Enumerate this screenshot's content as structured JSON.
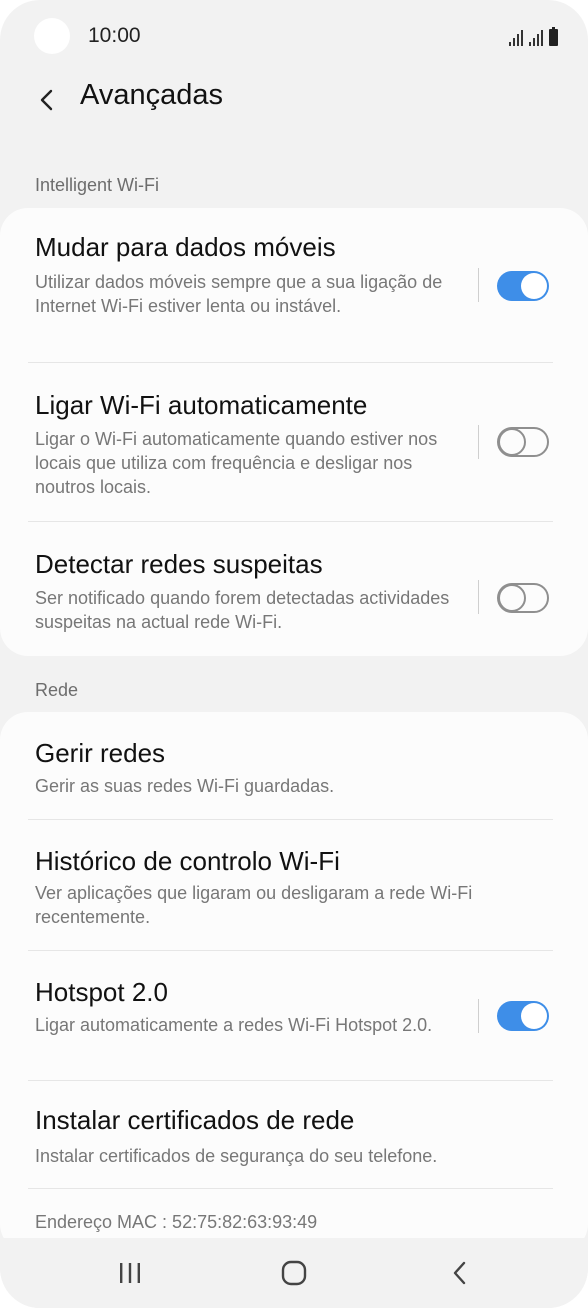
{
  "status_bar": {
    "time": "10:00"
  },
  "header": {
    "title": "Avançadas"
  },
  "sections": [
    {
      "label": "Intelligent Wi-Fi",
      "items": [
        {
          "name": "Mudar para dados móveis",
          "description": "Utilizar dados móveis sempre que a sua ligação de Internet Wi-Fi estiver lenta ou instável.",
          "toggle": true
        },
        {
          "name": "Ligar Wi-Fi automaticamente",
          "description": "Ligar o Wi-Fi automaticamente quando estiver nos locais que utiliza com frequência e desligar nos noutros locais.",
          "toggle": false
        },
        {
          "name": "Detectar redes suspeitas",
          "description": "Ser notificado quando forem detectadas actividades suspeitas na actual rede Wi-Fi.",
          "toggle": false
        }
      ]
    },
    {
      "label": "Rede",
      "items": [
        {
          "name": "Gerir redes",
          "description": "Gerir as suas redes Wi-Fi guardadas."
        },
        {
          "name": "Histórico de controlo Wi-Fi",
          "description": "Ver aplicações que ligaram ou desligaram a rede Wi-Fi recentemente."
        },
        {
          "name": "Hotspot 2.0",
          "description": "Ligar automaticamente a redes Wi-Fi Hotspot 2.0.",
          "toggle": true
        },
        {
          "name": "Instalar certificados de rede",
          "description": "Instalar certificados de segurança do seu telefone."
        }
      ]
    }
  ],
  "mac_address": "Endereço MAC : 52:75:82:63:93:49",
  "colors": {
    "accent": "#3e8ee8",
    "background": "#f2f2f2",
    "card": "#fcfcfc"
  },
  "icons": {
    "back": "chevron-left-icon",
    "nav_recents": "recents-icon",
    "nav_home": "home-icon",
    "nav_back": "back-icon"
  }
}
